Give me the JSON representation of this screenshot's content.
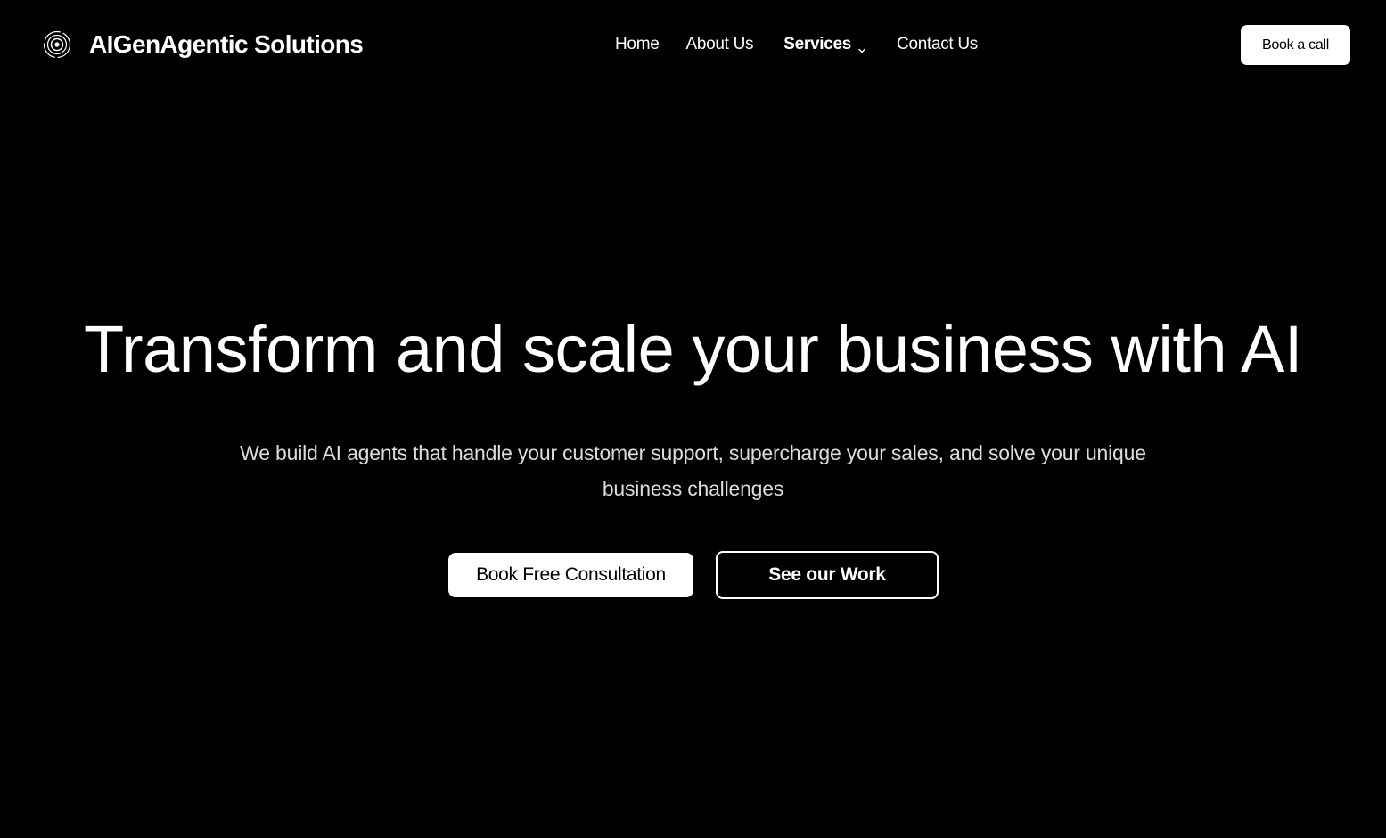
{
  "header": {
    "brand": {
      "name": "AIGenAgentic Solutions",
      "icon": "concentric-circles-logo-icon"
    },
    "nav": {
      "items": [
        {
          "label": "Home"
        },
        {
          "label": "About Us"
        },
        {
          "label": "Services",
          "icon": "chevron-down-icon"
        },
        {
          "label": "Contact Us"
        }
      ]
    },
    "cta": {
      "label": "Book a call"
    }
  },
  "hero": {
    "title": "Transform and scale your business with AI",
    "subtitle": "We build AI agents that handle your customer support, supercharge your sales, and solve your unique business challenges",
    "primary_button": "Book Free Consultation",
    "secondary_button": "See our Work"
  },
  "colors": {
    "background": "#000000",
    "text": "#ffffff",
    "subtitle_text": "#dcdcdc",
    "button_fill": "#ffffff"
  }
}
